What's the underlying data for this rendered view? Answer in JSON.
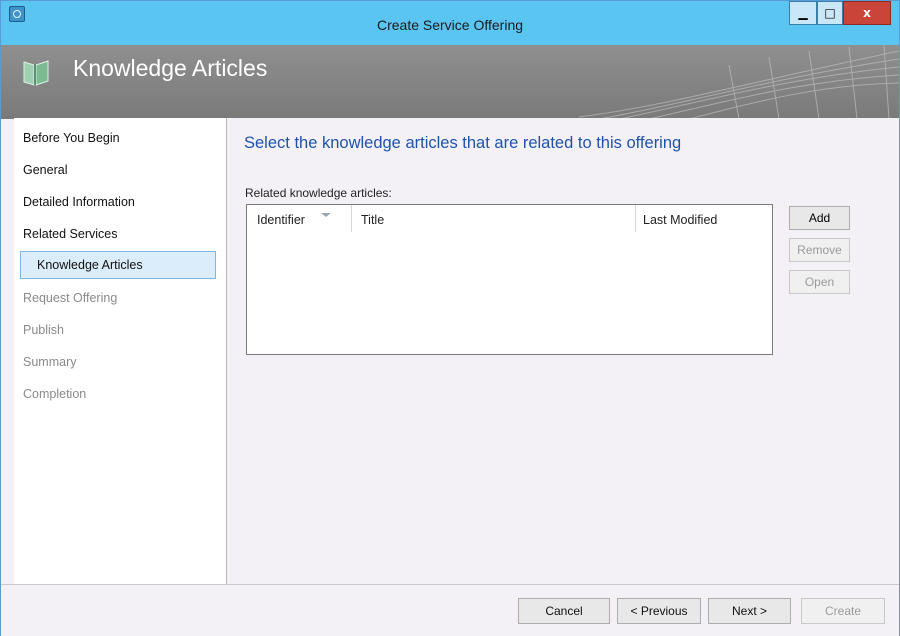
{
  "window": {
    "title": "Create Service Offering",
    "minimize_label": "▁",
    "maximize_label": "□",
    "close_label": "x"
  },
  "banner": {
    "title": "Knowledge Articles"
  },
  "sidebar": {
    "items": [
      {
        "label": "Before You Begin",
        "state": "normal"
      },
      {
        "label": "General",
        "state": "normal"
      },
      {
        "label": "Detailed Information",
        "state": "normal"
      },
      {
        "label": "Related Services",
        "state": "normal"
      },
      {
        "label": "Knowledge Articles",
        "state": "selected"
      },
      {
        "label": "Request Offering",
        "state": "disabled"
      },
      {
        "label": "Publish",
        "state": "disabled"
      },
      {
        "label": "Summary",
        "state": "disabled"
      },
      {
        "label": "Completion",
        "state": "disabled"
      }
    ]
  },
  "main": {
    "heading": "Select the knowledge articles that are related to this offering",
    "list_label": "Related knowledge articles:",
    "columns": [
      "Identifier",
      "Title",
      "Last Modified"
    ],
    "rows": []
  },
  "actions": {
    "add": "Add",
    "remove": "Remove",
    "open": "Open"
  },
  "footer": {
    "cancel": "Cancel",
    "previous": "< Previous",
    "next": "Next >",
    "create": "Create"
  },
  "colors": {
    "titlebar": "#5bc5f2",
    "heading": "#1d53ad",
    "selected_bg": "#dbedfa",
    "close_button": "#c9453a"
  }
}
